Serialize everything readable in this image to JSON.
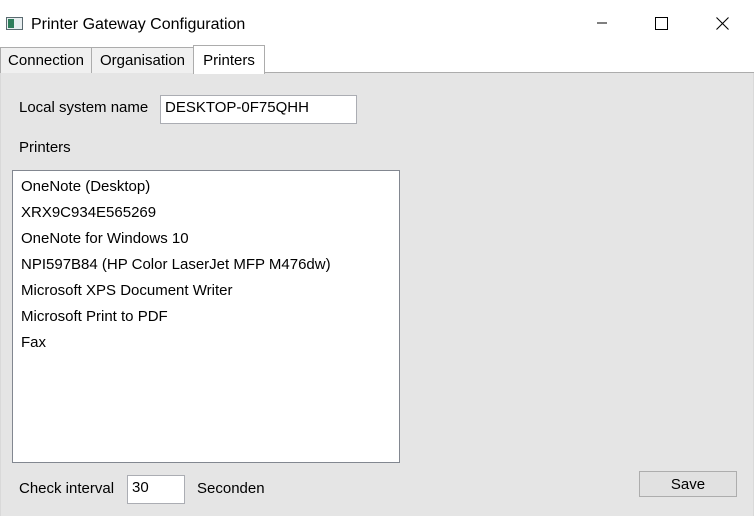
{
  "window": {
    "title": "Printer Gateway Configuration",
    "minimize_icon": "minimize-icon",
    "maximize_icon": "maximize-icon",
    "close_icon": "close-icon"
  },
  "tabs": [
    {
      "label": "Connection",
      "active": false
    },
    {
      "label": "Organisation",
      "active": false
    },
    {
      "label": "Printers",
      "active": true
    }
  ],
  "printers_tab": {
    "local_system_label": "Local system name",
    "local_system_value": "DESKTOP-0F75QHH",
    "printers_label": "Printers",
    "printers": [
      "OneNote (Desktop)",
      "XRX9C934E565269",
      "OneNote for Windows 10",
      "NPI597B84 (HP Color LaserJet MFP M476dw)",
      "Microsoft XPS Document Writer",
      "Microsoft Print to PDF",
      "Fax"
    ],
    "check_interval_label": "Check interval",
    "check_interval_value": "30",
    "seconds_label": "Seconden",
    "save_label": "Save"
  }
}
